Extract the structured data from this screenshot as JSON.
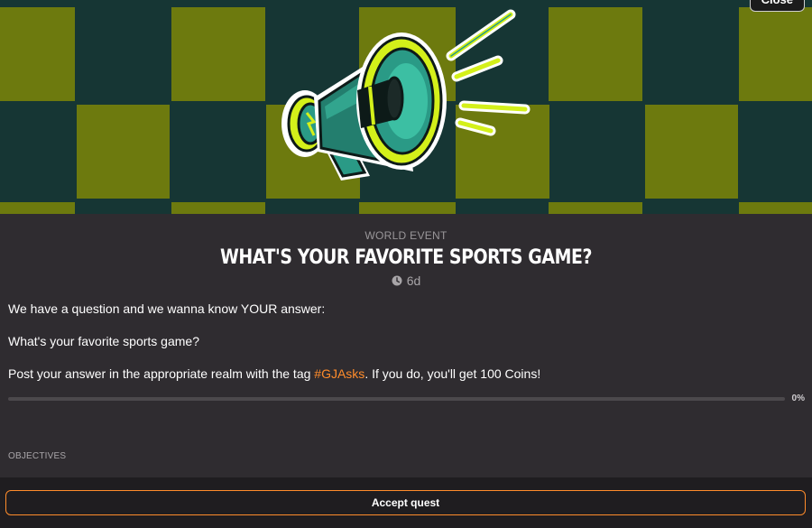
{
  "hero": {
    "close_label": "Close",
    "colors": {
      "dark": "#163634",
      "olive": "#6d7a0e",
      "neon": "#d4f01a",
      "teal": "#2a9a86"
    }
  },
  "quest": {
    "category": "WORLD EVENT",
    "title": "WHAT'S YOUR FAVORITE SPORTS GAME?",
    "time_remaining": "6d",
    "description": {
      "line1": "We have a question and we wanna know YOUR answer:",
      "line2": "What's your favorite sports game?",
      "line3_before": "Post your answer in the appropriate realm with the tag ",
      "hashtag": "#GJAsks",
      "line3_after": ". If you do, you'll get 100 Coins!"
    },
    "progress_value": 0,
    "progress_label": "0%",
    "objectives_label": "OBJECTIVES"
  },
  "footer": {
    "accept_label": "Accept quest"
  },
  "accent_color": "#ff8c2b"
}
